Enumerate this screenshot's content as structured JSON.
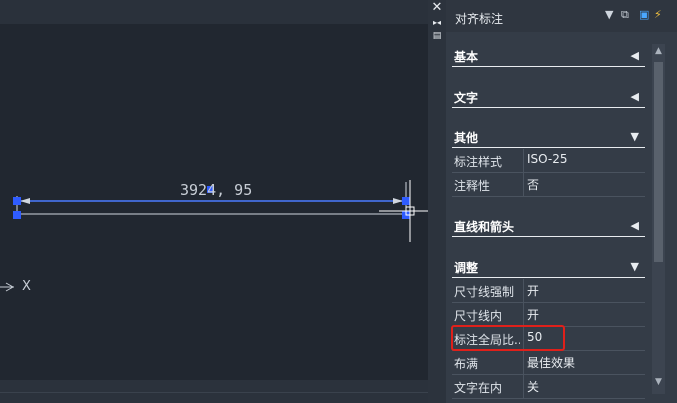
{
  "canvas": {
    "dimension_text": "3924, 95",
    "axis_label": "X"
  },
  "panel": {
    "title": "对齐标注",
    "sections": [
      {
        "label": "基本",
        "expanded": false
      },
      {
        "label": "文字",
        "expanded": false
      },
      {
        "label": "其他",
        "expanded": true
      },
      {
        "label": "直线和箭头",
        "expanded": false
      },
      {
        "label": "调整",
        "expanded": true
      }
    ],
    "other_rows": [
      {
        "name": "标注样式",
        "value": "ISO-25"
      },
      {
        "name": "注释性",
        "value": "否"
      }
    ],
    "adjust_rows": [
      {
        "name": "尺寸线强制",
        "value": "开"
      },
      {
        "name": "尺寸线内",
        "value": "开"
      },
      {
        "name": "标注全局比...",
        "value": "50"
      },
      {
        "name": "布满",
        "value": "最佳效果"
      },
      {
        "name": "文字在内",
        "value": "关"
      }
    ]
  },
  "colors": {
    "canvas_bg": "#212730",
    "panel_bg": "#343c47",
    "dimension_line": "#4a7cff",
    "highlight": "#e0201a"
  }
}
